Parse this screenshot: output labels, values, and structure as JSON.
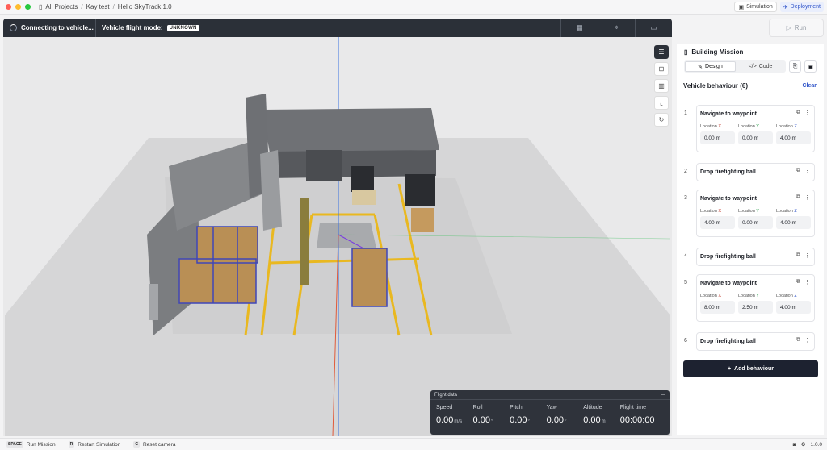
{
  "titlebar": {
    "breadcrumbs": [
      "All Projects",
      "Kay test",
      "Hello SkyTrack 1.0"
    ],
    "simulation_label": "Simulation",
    "deployment_label": "Deployment"
  },
  "topbar": {
    "connecting_label": "Connecting to vehicle...",
    "flight_mode_label": "Vehicle flight mode:",
    "flight_mode_value": "UNKNOWN",
    "run_label": "Run"
  },
  "flight_data": {
    "title": "Flight data",
    "speed_label": "Speed",
    "speed_value": "0.00",
    "speed_unit": "m/s",
    "roll_label": "Roll",
    "roll_value": "0.00",
    "roll_unit": "°",
    "pitch_label": "Pitch",
    "pitch_value": "0.00",
    "pitch_unit": "°",
    "yaw_label": "Yaw",
    "yaw_value": "0.00",
    "yaw_unit": "°",
    "altitude_label": "Altitude",
    "altitude_value": "0.00",
    "altitude_unit": "m",
    "flight_time_label": "Flight time",
    "flight_time_value": "00:00:00"
  },
  "shortcuts": [
    {
      "key": "SPACE",
      "label": "Run Mission"
    },
    {
      "key": "R",
      "label": "Restart Simulation"
    },
    {
      "key": "C",
      "label": "Reset camera"
    }
  ],
  "version": "1.0.0",
  "panel": {
    "title": "Building Mission",
    "design_tab": "Design",
    "code_tab": "Code",
    "section_title": "Vehicle behaviour (6)",
    "clear_label": "Clear",
    "add_label": "Add behaviour",
    "loc_x_label": "Location",
    "loc_x_axis": "X",
    "loc_y_axis": "Y",
    "loc_z_axis": "Z",
    "behaviours": [
      {
        "num": "1",
        "title": "Navigate to waypoint",
        "x": "0.00 m",
        "y": "0.00 m",
        "z": "4.00 m"
      },
      {
        "num": "2",
        "title": "Drop firefighting ball"
      },
      {
        "num": "3",
        "title": "Navigate to waypoint",
        "x": "4.00 m",
        "y": "0.00 m",
        "z": "4.00 m"
      },
      {
        "num": "4",
        "title": "Drop firefighting ball"
      },
      {
        "num": "5",
        "title": "Navigate to waypoint",
        "x": "8.00 m",
        "y": "2.50 m",
        "z": "4.00 m"
      },
      {
        "num": "6",
        "title": "Drop firefighting ball"
      }
    ]
  }
}
